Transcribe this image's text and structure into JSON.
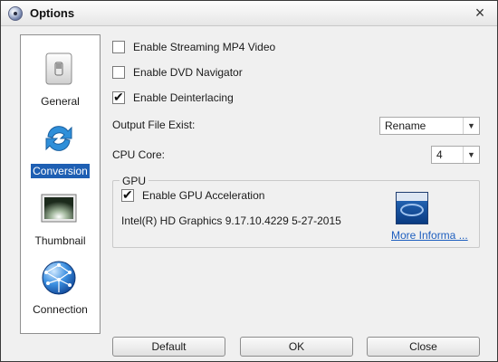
{
  "window": {
    "title": "Options"
  },
  "sidebar": {
    "items": [
      {
        "label": "General",
        "icon": "switch-icon",
        "selected": false
      },
      {
        "label": "Conversion",
        "icon": "refresh-arrows-icon",
        "selected": true
      },
      {
        "label": "Thumbnail",
        "icon": "monitor-icon",
        "selected": false
      },
      {
        "label": "Connection",
        "icon": "globe-icon",
        "selected": false
      }
    ]
  },
  "options": {
    "streaming_mp4": {
      "label": "Enable Streaming MP4 Video",
      "checked": false
    },
    "dvd_navigator": {
      "label": "Enable DVD Navigator",
      "checked": false
    },
    "deinterlacing": {
      "label": "Enable Deinterlacing",
      "checked": true
    }
  },
  "output_file": {
    "label": "Output File Exist:",
    "value": "Rename"
  },
  "cpu_core": {
    "label": "CPU Core:",
    "value": "4"
  },
  "gpu": {
    "group_title": "GPU",
    "acceleration": {
      "label": "Enable GPU Acceleration",
      "checked": true
    },
    "info": "Intel(R) HD Graphics 9.17.10.4229 5-27-2015",
    "more_link": "More Informa ..."
  },
  "buttons": {
    "default": "Default",
    "ok": "OK",
    "close": "Close"
  }
}
